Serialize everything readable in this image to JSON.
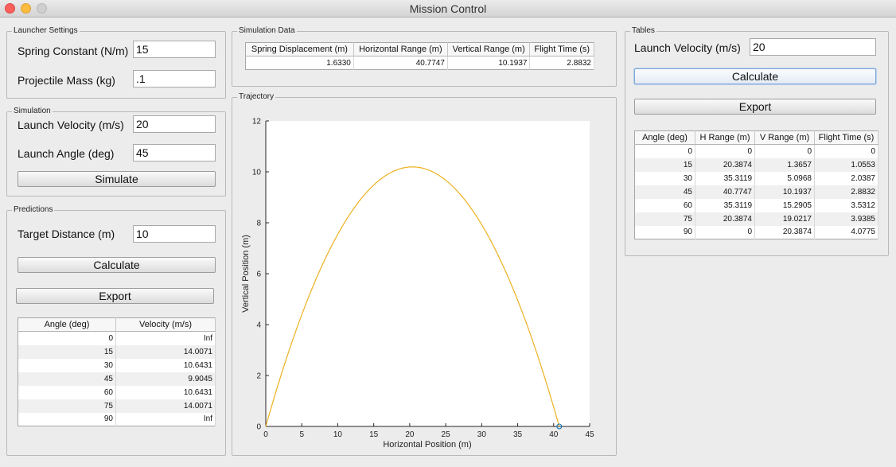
{
  "window": {
    "title": "Mission Control"
  },
  "launcher_settings": {
    "title": "Launcher Settings",
    "spring_constant_label": "Spring Constant (N/m)",
    "spring_constant_value": "15",
    "projectile_mass_label": "Projectile Mass (kg)",
    "projectile_mass_value": ".1"
  },
  "simulation": {
    "title": "Simulation",
    "launch_velocity_label": "Launch Velocity (m/s)",
    "launch_velocity_value": "20",
    "launch_angle_label": "Launch Angle (deg)",
    "launch_angle_value": "45",
    "simulate_label": "Simulate"
  },
  "predictions": {
    "title": "Predictions",
    "target_distance_label": "Target Distance (m)",
    "target_distance_value": "10",
    "calculate_label": "Calculate",
    "export_label": "Export",
    "table": {
      "headers": [
        "Angle (deg)",
        "Velocity (m/s)"
      ],
      "rows": [
        [
          "0",
          "Inf"
        ],
        [
          "15",
          "14.0071"
        ],
        [
          "30",
          "10.6431"
        ],
        [
          "45",
          "9.9045"
        ],
        [
          "60",
          "10.6431"
        ],
        [
          "75",
          "14.0071"
        ],
        [
          "90",
          "Inf"
        ]
      ]
    }
  },
  "simulation_data": {
    "title": "Simulation Data",
    "headers": [
      "Spring Displacement (m)",
      "Horizontal Range (m)",
      "Vertical Range (m)",
      "Flight Time (s)"
    ],
    "row": [
      "1.6330",
      "40.7747",
      "10.1937",
      "2.8832"
    ]
  },
  "trajectory": {
    "title": "Trajectory"
  },
  "tables": {
    "title": "Tables",
    "launch_velocity_label": "Launch Velocity (m/s)",
    "launch_velocity_value": "20",
    "calculate_label": "Calculate",
    "export_label": "Export",
    "table": {
      "headers": [
        "Angle (deg)",
        "H Range (m)",
        "V Range (m)",
        "Flight Time (s)"
      ],
      "rows": [
        [
          "0",
          "0",
          "0",
          "0"
        ],
        [
          "15",
          "20.3874",
          "1.3657",
          "1.0553"
        ],
        [
          "30",
          "35.3119",
          "5.0968",
          "2.0387"
        ],
        [
          "45",
          "40.7747",
          "10.1937",
          "2.8832"
        ],
        [
          "60",
          "35.3119",
          "15.2905",
          "3.5312"
        ],
        [
          "75",
          "20.3874",
          "19.0217",
          "3.9385"
        ],
        [
          "90",
          "0",
          "20.3874",
          "4.0775"
        ]
      ]
    }
  },
  "colors": {
    "trajectory_line": "#edb120",
    "endpoint_marker": "#0072bd"
  },
  "chart_data": {
    "type": "line",
    "title": "",
    "xlabel": "Horizontal Position (m)",
    "ylabel": "Vertical Position (m)",
    "xlim": [
      0,
      45
    ],
    "ylim": [
      0,
      12
    ],
    "xticks": [
      "0",
      "5",
      "10",
      "15",
      "20",
      "25",
      "30",
      "35",
      "40",
      "45"
    ],
    "yticks": [
      "0",
      "2",
      "4",
      "6",
      "8",
      "10",
      "12"
    ],
    "grid": false,
    "series": [
      {
        "model": "projectile",
        "v0": 20,
        "angle_deg": 45,
        "g": 9.81,
        "x_end": 40.7747,
        "y_max": 10.1937
      }
    ],
    "markers": [
      {
        "x": 40.7747,
        "y": 0,
        "shape": "circle"
      }
    ]
  }
}
